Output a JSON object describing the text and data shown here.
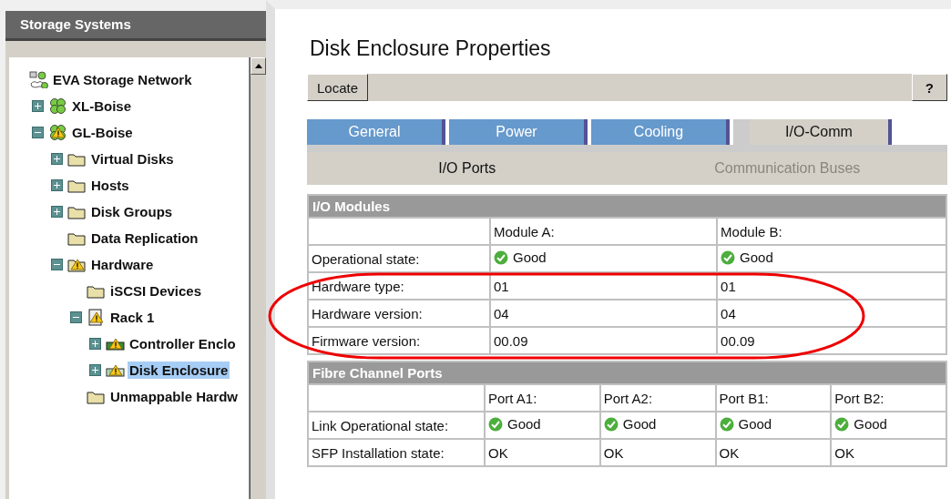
{
  "sidebar": {
    "title": "Storage Systems",
    "tree": [
      {
        "label": "EVA Storage Network",
        "kind": "network",
        "warning": false,
        "selected": false,
        "children": [
          {
            "label": "XL-Boise",
            "kind": "system",
            "warning": false,
            "selected": false,
            "expanded": false
          },
          {
            "label": "GL-Boise",
            "kind": "system",
            "warning": true,
            "selected": false,
            "expanded": true,
            "children": [
              {
                "label": "Virtual Disks",
                "kind": "folder",
                "warning": false,
                "selected": false,
                "expanded": false
              },
              {
                "label": "Hosts",
                "kind": "folder",
                "warning": false,
                "selected": false,
                "expanded": false
              },
              {
                "label": "Disk Groups",
                "kind": "folder",
                "warning": false,
                "selected": false,
                "expanded": false
              },
              {
                "label": "Data Replication",
                "kind": "folder",
                "warning": false,
                "selected": false
              },
              {
                "label": "Hardware",
                "kind": "folder",
                "warning": true,
                "selected": false,
                "expanded": true,
                "children": [
                  {
                    "label": "iSCSI Devices",
                    "kind": "folder",
                    "warning": false,
                    "selected": false
                  },
                  {
                    "label": "Rack 1",
                    "kind": "rack",
                    "warning": true,
                    "selected": false,
                    "expanded": true,
                    "children": [
                      {
                        "label": "Controller Enclo",
                        "kind": "controller",
                        "warning": true,
                        "selected": false,
                        "expanded": false
                      },
                      {
                        "label": "Disk Enclosure",
                        "kind": "disk-enclosure",
                        "warning": true,
                        "selected": true,
                        "expanded": false
                      }
                    ]
                  },
                  {
                    "label": "Unmappable Hardw",
                    "kind": "folder",
                    "warning": false,
                    "selected": false
                  }
                ]
              }
            ]
          }
        ]
      }
    ]
  },
  "page": {
    "title": "Disk Enclosure Properties",
    "toolbar": {
      "locate": "Locate",
      "help": "?"
    },
    "tabs": [
      {
        "label": "General",
        "selected": false
      },
      {
        "label": "Power",
        "selected": false
      },
      {
        "label": "Cooling",
        "selected": false
      },
      {
        "label": "I/O-Comm",
        "selected": true
      }
    ],
    "subtabs": [
      {
        "label": "I/O Ports",
        "selected": true
      },
      {
        "label": "Communication Buses",
        "selected": false
      }
    ],
    "tables": [
      {
        "title": "I/O Modules",
        "columns": [
          "Module A:",
          "Module B:"
        ],
        "rows": [
          {
            "label": "Operational state:",
            "cells": [
              {
                "text": "Good",
                "kind": "status"
              },
              {
                "text": "Good",
                "kind": "status"
              }
            ]
          },
          {
            "label": "Hardware type:",
            "cells": [
              {
                "text": "01",
                "kind": "text"
              },
              {
                "text": "01",
                "kind": "text"
              }
            ]
          },
          {
            "label": "Hardware version:",
            "cells": [
              {
                "text": "04",
                "kind": "text"
              },
              {
                "text": "04",
                "kind": "text"
              }
            ]
          },
          {
            "label": "Firmware version:",
            "cells": [
              {
                "text": "00.09",
                "kind": "text"
              },
              {
                "text": "00.09",
                "kind": "text"
              }
            ]
          }
        ]
      },
      {
        "title": "Fibre Channel Ports",
        "columns": [
          "Port A1:",
          "Port A2:",
          "Port B1:",
          "Port B2:"
        ],
        "rows": [
          {
            "label": "Link Operational state:",
            "cells": [
              {
                "text": "Good",
                "kind": "status"
              },
              {
                "text": "Good",
                "kind": "status"
              },
              {
                "text": "Good",
                "kind": "status"
              },
              {
                "text": "Good",
                "kind": "status"
              }
            ]
          },
          {
            "label": "SFP Installation state:",
            "cells": [
              {
                "text": "OK",
                "kind": "text"
              },
              {
                "text": "OK",
                "kind": "text"
              },
              {
                "text": "OK",
                "kind": "text"
              },
              {
                "text": "OK",
                "kind": "text"
              }
            ]
          }
        ]
      }
    ]
  }
}
